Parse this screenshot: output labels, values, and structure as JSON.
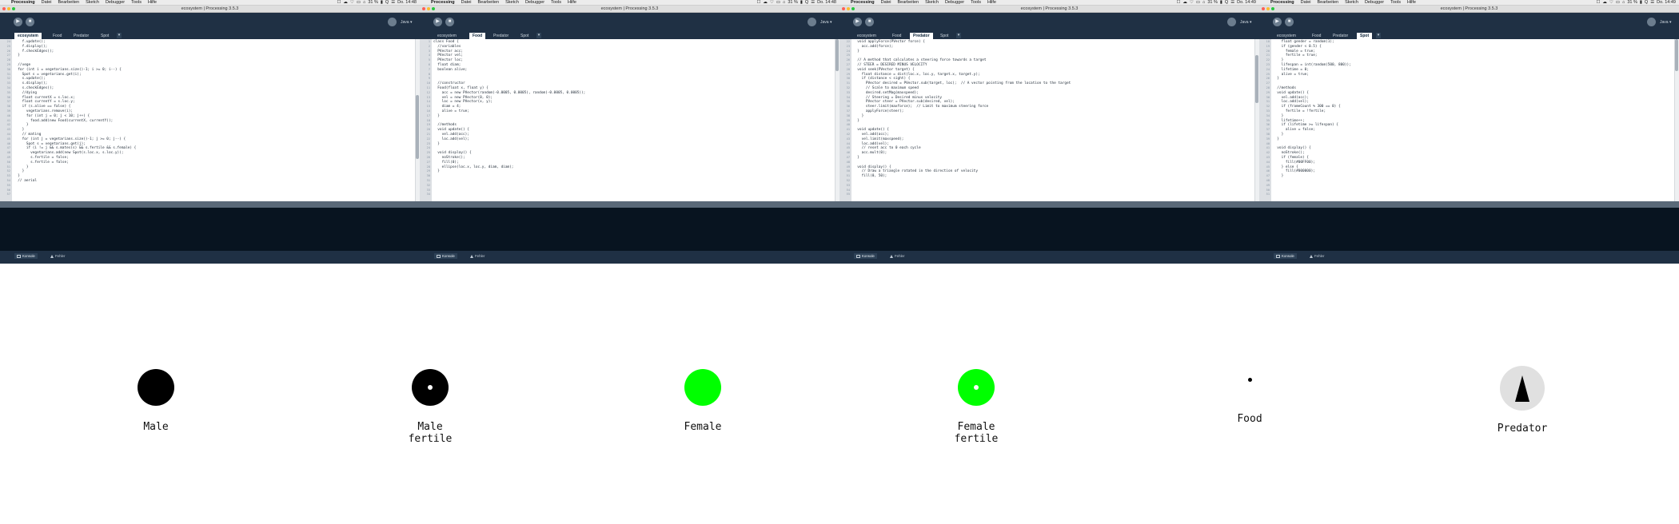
{
  "menubar": {
    "app": "Processing",
    "items": [
      "Datei",
      "Bearbeiten",
      "Sketch",
      "Debugger",
      "Tools",
      "Hilfe"
    ],
    "status": [
      "☐",
      "☁",
      "♡",
      "▭",
      "⌂",
      "31 %",
      "▮",
      "Q",
      "☰"
    ]
  },
  "windows": [
    {
      "time": "Do. 14:48",
      "title": "ecosystem | Processing 3.5.3",
      "mode": "Java ▾",
      "tabs": [
        "ecosystem",
        "Food",
        "Predator",
        "Spot"
      ],
      "active_tab": 0,
      "line_numbers": [
        "24",
        "25",
        "26",
        "27",
        "28",
        "29",
        "30",
        "31",
        "32",
        "33",
        "34",
        "35",
        "36",
        "37",
        "38",
        "39",
        "40",
        "41",
        "42",
        "43",
        "44",
        "45",
        "46",
        "47",
        "48",
        "49",
        "50",
        "51",
        "52",
        "53",
        "54",
        "55",
        "56",
        "57"
      ],
      "code": [
        "    f.update();",
        "    f.display();",
        "    f.checkEdges();",
        "  }",
        "",
        "  //vege",
        "  for (int i = vegetarians.size()-1; i >= 0; i--) {",
        "    Spot s = vegetarians.get(i);",
        "    s.update();",
        "    s.display();",
        "    s.checkEdges();",
        "    //dying",
        "    float currentX = s.loc.x;",
        "    float currentY = s.loc.y;",
        "    if (s.alive == false) {",
        "      vegetarians.remove(i);",
        "      for (int j = 0; j < 10; j++) {",
        "        food.add(new Food(currentX, currentY));",
        "      }",
        "    }",
        "    // mating",
        "    for (int j = vegetarians.size()-1; j >= 0; j--) {",
        "      Spot s = vegetarians.get(j);",
        "      if (i != j && s.mates(s) && s.fertile && s.female) {",
        "        vegetarians.add(new Spot(s.loc.x, s.loc.y));",
        "        s.fertile = false;",
        "        s.fertile = false;",
        "      }",
        "    }",
        "  }",
        "  // aerial"
      ]
    },
    {
      "time": "Do. 14:48",
      "title": "ecosystem | Processing 3.5.3",
      "mode": "Java ▾",
      "tabs": [
        "ecosystem",
        "Food",
        "Predator",
        "Spot"
      ],
      "active_tab": 1,
      "line_numbers": [
        "1",
        "2",
        "3",
        "4",
        "5",
        "6",
        "7",
        "8",
        "9",
        "10",
        "11",
        "12",
        "13",
        "14",
        "15",
        "16",
        "17",
        "18",
        "19",
        "20",
        "21",
        "22",
        "23",
        "24",
        "25",
        "26",
        "27",
        "28",
        "29",
        "30",
        "31",
        "32",
        "33",
        "34"
      ],
      "code": [
        "class Food {",
        "  //variables",
        "  PVector acc;",
        "  PVector vel;",
        "  PVector loc;",
        "  float diam;",
        "  boolean alive;",
        "",
        "",
        "  //constructor",
        "  Food(float x, float y) {",
        "    acc = new PVector(random(-0.0005, 0.0005), random(-0.0005, 0.0005));",
        "    vel = new PVector(0, 0);",
        "    loc = new PVector(x, y);",
        "    diam = 4;",
        "    alive = true;",
        "  }",
        "",
        "  //methods",
        "  void update() {",
        "    vel.add(acc);",
        "    loc.add(vel);",
        "  }",
        "",
        "  void display() {",
        "    noStroke();",
        "    fill(0);",
        "    ellipse(loc.x, loc.y, diam, diam);",
        "  }"
      ]
    },
    {
      "time": "Do. 14:49",
      "title": "ecosystem | Processing 3.5.3",
      "mode": "Java ▾",
      "tabs": [
        "ecosystem",
        "Food",
        "Predator",
        "Spot"
      ],
      "active_tab": 2,
      "line_numbers": [
        "22",
        "23",
        "24",
        "25",
        "26",
        "27",
        "28",
        "29",
        "30",
        "31",
        "32",
        "33",
        "34",
        "35",
        "36",
        "37",
        "38",
        "39",
        "40",
        "41",
        "42",
        "43",
        "44",
        "45",
        "46",
        "47",
        "48",
        "49",
        "50",
        "51",
        "52",
        "53",
        "54",
        "55"
      ],
      "code": [
        "  void applyForce(PVector force) {",
        "    acc.add(force);",
        "  }",
        "",
        "  // A method that calculates a steering force towards a target",
        "  // STEER = DESIRED MINUS VELOCITY",
        "  void seek(PVector target) {",
        "    float distance = dist(loc.x, loc.y, target.x, target.y);",
        "    if (distance < sight) {",
        "      PVector desired = PVector.sub(target, loc);  // A vector pointing from the location to the target",
        "      // Scale to maximum speed",
        "      desired.setMag(maxspeed);",
        "      // Steering = Desired minus velocity",
        "      PVector steer = PVector.sub(desired, vel);",
        "      steer.limit(maxforce);  // Limit to maximum steering force",
        "      applyForce(steer);",
        "    }",
        "  }",
        "",
        "  void update() {",
        "    vel.add(acc);",
        "    vel.limit(maxspeed);",
        "    loc.add(vel);",
        "    // reset acc to 0 each cycle",
        "    acc.mult(0);",
        "  }",
        "",
        "  void display() {",
        "    // Draw a triangle rotated in the direction of velocity",
        "    fill(0, 50);"
      ]
    },
    {
      "time": "Do. 14:49",
      "title": "ecosystem | Processing 3.5.3",
      "mode": "Java ▾",
      "tabs": [
        "ecosystem",
        "Food",
        "Predator",
        "Spot"
      ],
      "active_tab": 3,
      "line_numbers": [
        "18",
        "19",
        "20",
        "21",
        "22",
        "23",
        "24",
        "25",
        "26",
        "27",
        "28",
        "29",
        "30",
        "31",
        "32",
        "33",
        "34",
        "35",
        "36",
        "37",
        "38",
        "39",
        "40",
        "41",
        "42",
        "43",
        "44",
        "45",
        "46",
        "47",
        "48",
        "49",
        "50",
        "51"
      ],
      "code": [
        "    float gender = random(1);",
        "    if (gender < 0.5) {",
        "      female = true;",
        "      fertile = true;",
        "    }",
        "    lifespan = int(random(500, 800));",
        "    lifetime = 0;",
        "    alive = true;",
        "  }",
        "",
        "  //methods",
        "  void update() {",
        "    vel.add(acc);",
        "    loc.add(vel);",
        "    if (frameCount % 300 == 0) {",
        "      fertile = !fertile;",
        "    }",
        "    lifetime++;",
        "    if (lifetime >= lifespan) {",
        "      alive = false;",
        "    }",
        "  }",
        "",
        "  void display() {",
        "    noStroke();",
        "    if (female) {",
        "      fill(#00FF00);",
        "    } else {",
        "      fill(#000000);",
        "    }"
      ]
    }
  ],
  "footer": {
    "console": "Konsole",
    "errors": "Fehler"
  },
  "legend": [
    {
      "label": "Male",
      "type": "circle",
      "color": "#000000",
      "dot": false
    },
    {
      "label": "Male\nfertile",
      "type": "circle",
      "color": "#000000",
      "dot": true
    },
    {
      "label": "Female",
      "type": "circle",
      "color": "#00ff00",
      "dot": false
    },
    {
      "label": "Female\nfertile",
      "type": "circle",
      "color": "#00ff00",
      "dot": true
    },
    {
      "label": "Food",
      "type": "food",
      "color": "#000000"
    },
    {
      "label": "Predator",
      "type": "predator",
      "color": "#000000"
    }
  ],
  "colors": {
    "window_bg": "#1e2f42",
    "console_bg": "#081420",
    "male": "#000000",
    "female": "#00ff00",
    "predator_circle": "#e0e0e0"
  }
}
